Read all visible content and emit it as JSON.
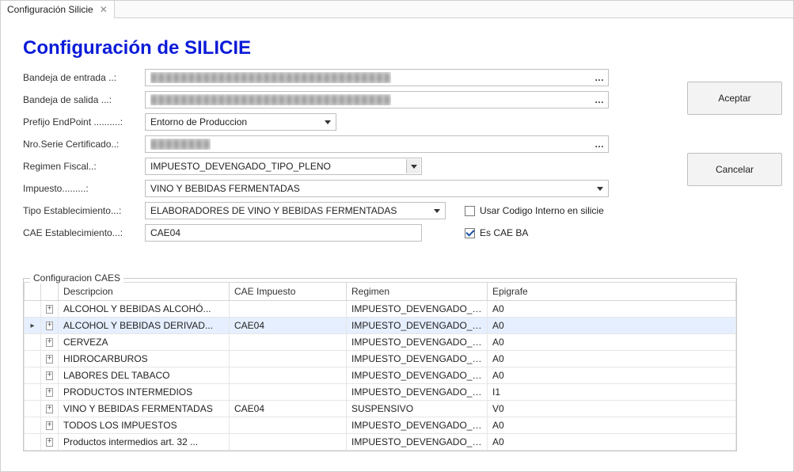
{
  "tab": {
    "label": "Configuración Silicie"
  },
  "title": "Configuración de SILICIE",
  "labels": {
    "bandeja_entrada": "Bandeja de entrada ..:",
    "bandeja_salida": "Bandeja de salida ...:",
    "prefijo_endpoint": "Prefijo EndPoint ..........:",
    "nro_serie_cert": "Nro.Serie Certificado..:",
    "regimen_fiscal": "Regimen Fiscal..:",
    "impuesto": "Impuesto.........:",
    "tipo_establecimiento": "Tipo Establecimiento...:",
    "cae_establecimiento": "CAE Establecimiento...:",
    "usar_codigo_interno": "Usar Codigo Interno en silicie",
    "es_cae_ba": "Es CAE BA"
  },
  "values": {
    "bandeja_entrada_masked": "████████████████████████████████",
    "bandeja_salida_masked": "████████████████████████████████",
    "prefijo_endpoint": "Entorno de Produccion",
    "nro_serie_cert_masked": "████████",
    "regimen_fiscal": "IMPUESTO_DEVENGADO_TIPO_PLENO",
    "impuesto": "VINO Y BEBIDAS FERMENTADAS",
    "tipo_establecimiento": "ELABORADORES DE VINO Y BEBIDAS FERMENTADAS",
    "cae_establecimiento": "CAE04",
    "usar_codigo_interno_checked": false,
    "es_cae_ba_checked": true
  },
  "buttons": {
    "aceptar": "Aceptar",
    "cancelar": "Cancelar"
  },
  "caes": {
    "title": "Configuracion CAES",
    "columns": {
      "descripcion": "Descripcion",
      "cae_impuesto": "CAE Impuesto",
      "regimen": "Regimen",
      "epigrafe": "Epigrafe"
    },
    "rows": [
      {
        "descripcion": "ALCOHOL Y BEBIDAS ALCOHÓ...",
        "cae_impuesto": "",
        "regimen": "IMPUESTO_DEVENGADO_TIPO_...",
        "epigrafe": "A0",
        "selected": false
      },
      {
        "descripcion": "ALCOHOL Y BEBIDAS DERIVAD...",
        "cae_impuesto": "CAE04",
        "regimen": "IMPUESTO_DEVENGADO_TIPO_...",
        "epigrafe": "A0",
        "selected": true
      },
      {
        "descripcion": "CERVEZA",
        "cae_impuesto": "",
        "regimen": "IMPUESTO_DEVENGADO_TIPO_...",
        "epigrafe": "A0",
        "selected": false
      },
      {
        "descripcion": "HIDROCARBUROS",
        "cae_impuesto": "",
        "regimen": "IMPUESTO_DEVENGADO_TIPO_...",
        "epigrafe": "A0",
        "selected": false
      },
      {
        "descripcion": "LABORES DEL TABACO",
        "cae_impuesto": "",
        "regimen": "IMPUESTO_DEVENGADO_TIPO_...",
        "epigrafe": "A0",
        "selected": false
      },
      {
        "descripcion": "PRODUCTOS INTERMEDIOS",
        "cae_impuesto": "",
        "regimen": "IMPUESTO_DEVENGADO_TIPO_...",
        "epigrafe": "I1",
        "selected": false
      },
      {
        "descripcion": "VINO Y BEBIDAS FERMENTADAS",
        "cae_impuesto": "CAE04",
        "regimen": "SUSPENSIVO",
        "epigrafe": "V0",
        "selected": false
      },
      {
        "descripcion": "TODOS LOS IMPUESTOS",
        "cae_impuesto": "",
        "regimen": "IMPUESTO_DEVENGADO_TIPO_...",
        "epigrafe": "A0",
        "selected": false
      },
      {
        "descripcion": "Productos intermedios art. 32 ...",
        "cae_impuesto": "",
        "regimen": "IMPUESTO_DEVENGADO_TIPO_...",
        "epigrafe": "A0",
        "selected": false
      }
    ]
  }
}
